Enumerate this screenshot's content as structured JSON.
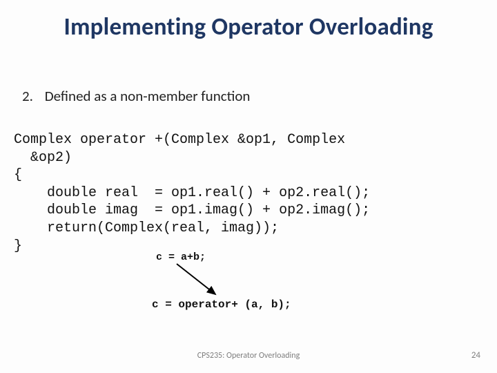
{
  "title": "Implementing Operator Overloading",
  "bullet": {
    "num": "2.",
    "text": "Defined as a non-member function"
  },
  "code": {
    "l1": "Complex operator +(Complex &op1, Complex",
    "l2": "  &op2)",
    "l3": "{",
    "l4": "    double real  = op1.real() + op2.real();",
    "l5": "    double imag  = op1.imag() + op2.imag();",
    "l6": "    return(Complex(real, imag));",
    "l7": "}"
  },
  "mini": {
    "short": "c = a+b;",
    "long": "c = operator+ (a, b);"
  },
  "footer": "CPS235: Operator Overloading",
  "pagenum": "24"
}
